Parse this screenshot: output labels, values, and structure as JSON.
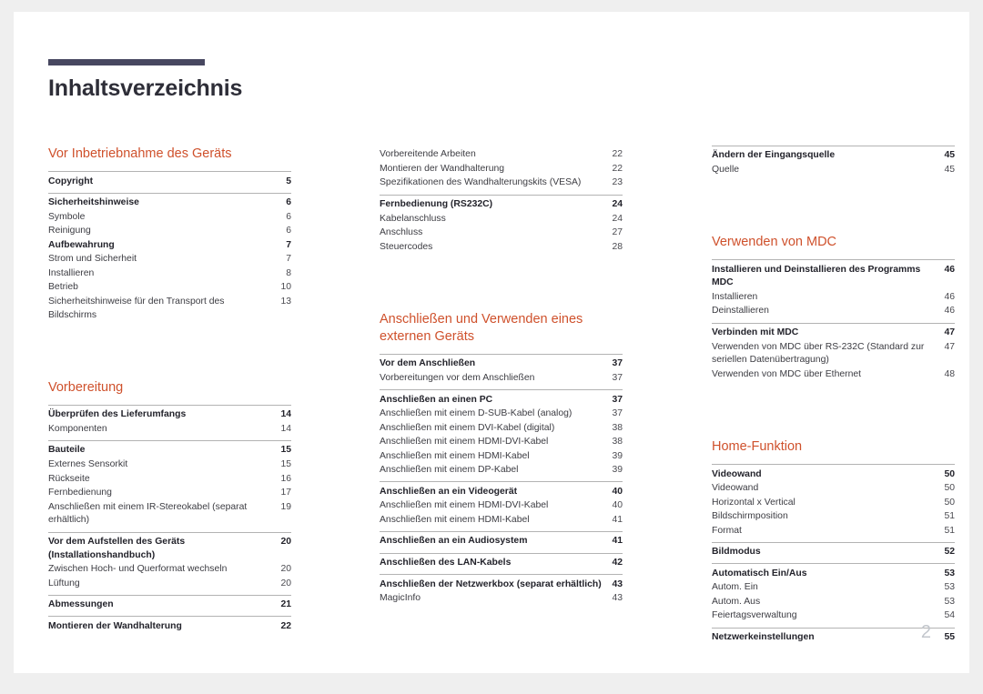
{
  "document": {
    "title": "Inhaltsverzeichnis",
    "folio": "2",
    "accent_color": "#cf512c",
    "rule_color": "#474760"
  },
  "columns": [
    {
      "id": "column-1",
      "sections": [
        {
          "heading": "Vor Inbetriebnahme des Geräts",
          "groups": [
            {
              "entries": [
                {
                  "label": "Copyright",
                  "page": "5",
                  "level": "head"
                }
              ]
            },
            {
              "entries": [
                {
                  "label": "Sicherheitshinweise",
                  "page": "6",
                  "level": "head"
                },
                {
                  "label": "Symbole",
                  "page": "6",
                  "level": "sub"
                },
                {
                  "label": "Reinigung",
                  "page": "6",
                  "level": "sub"
                },
                {
                  "label": "Aufbewahrung",
                  "page": "7",
                  "level": "head"
                },
                {
                  "label": "Strom und Sicherheit",
                  "page": "7",
                  "level": "sub"
                },
                {
                  "label": "Installieren",
                  "page": "8",
                  "level": "sub"
                },
                {
                  "label": "Betrieb",
                  "page": "10",
                  "level": "sub"
                },
                {
                  "label": "Sicherheitshinweise für den Transport des Bildschirms",
                  "page": "13",
                  "level": "sub"
                }
              ]
            }
          ]
        },
        {
          "heading": "Vorbereitung",
          "groups": [
            {
              "entries": [
                {
                  "label": "Überprüfen des Lieferumfangs",
                  "page": "14",
                  "level": "head"
                },
                {
                  "label": "Komponenten",
                  "page": "14",
                  "level": "sub"
                }
              ]
            },
            {
              "entries": [
                {
                  "label": "Bauteile",
                  "page": "15",
                  "level": "head"
                },
                {
                  "label": "Externes Sensorkit",
                  "page": "15",
                  "level": "sub"
                },
                {
                  "label": "Rückseite",
                  "page": "16",
                  "level": "sub"
                },
                {
                  "label": "Fernbedienung",
                  "page": "17",
                  "level": "sub"
                },
                {
                  "label": "Anschließen mit einem IR-Stereokabel (separat erhältlich)",
                  "page": "19",
                  "level": "sub"
                }
              ]
            },
            {
              "entries": [
                {
                  "label": "Vor dem Aufstellen des Geräts (Installationshandbuch)",
                  "page": "20",
                  "level": "head"
                },
                {
                  "label": "Zwischen Hoch- und Querformat wechseln",
                  "page": "20",
                  "level": "sub"
                },
                {
                  "label": "Lüftung",
                  "page": "20",
                  "level": "sub"
                }
              ]
            },
            {
              "entries": [
                {
                  "label": "Abmessungen",
                  "page": "21",
                  "level": "head"
                }
              ]
            },
            {
              "entries": [
                {
                  "label": "Montieren der Wandhalterung",
                  "page": "22",
                  "level": "head"
                }
              ]
            }
          ]
        }
      ]
    },
    {
      "id": "column-2",
      "sections": [
        {
          "heading": "",
          "groups": [
            {
              "no_rule": true,
              "entries": [
                {
                  "label": "Vorbereitende Arbeiten",
                  "page": "22",
                  "level": "sub"
                },
                {
                  "label": "Montieren der Wandhalterung",
                  "page": "22",
                  "level": "sub"
                },
                {
                  "label": "Spezifikationen des Wandhalterungskits (VESA)",
                  "page": "23",
                  "level": "sub"
                }
              ]
            },
            {
              "entries": [
                {
                  "label": "Fernbedienung (RS232C)",
                  "page": "24",
                  "level": "head"
                },
                {
                  "label": "Kabelanschluss",
                  "page": "24",
                  "level": "sub"
                },
                {
                  "label": "Anschluss",
                  "page": "27",
                  "level": "sub"
                },
                {
                  "label": "Steuercodes",
                  "page": "28",
                  "level": "sub"
                }
              ]
            }
          ]
        },
        {
          "heading": "Anschließen und Verwenden eines externen Geräts",
          "groups": [
            {
              "entries": [
                {
                  "label": "Vor dem Anschließen",
                  "page": "37",
                  "level": "head"
                },
                {
                  "label": "Vorbereitungen vor dem Anschließen",
                  "page": "37",
                  "level": "sub"
                }
              ]
            },
            {
              "entries": [
                {
                  "label": "Anschließen an einen PC",
                  "page": "37",
                  "level": "head"
                },
                {
                  "label": "Anschließen mit einem D-SUB-Kabel (analog)",
                  "page": "37",
                  "level": "sub"
                },
                {
                  "label": "Anschließen mit einem DVI-Kabel (digital)",
                  "page": "38",
                  "level": "sub"
                },
                {
                  "label": "Anschließen mit einem HDMI-DVI-Kabel",
                  "page": "38",
                  "level": "sub"
                },
                {
                  "label": "Anschließen mit einem HDMI-Kabel",
                  "page": "39",
                  "level": "sub"
                },
                {
                  "label": "Anschließen mit einem DP-Kabel",
                  "page": "39",
                  "level": "sub"
                }
              ]
            },
            {
              "entries": [
                {
                  "label": "Anschließen an ein Videogerät",
                  "page": "40",
                  "level": "head"
                },
                {
                  "label": "Anschließen mit einem HDMI-DVI-Kabel",
                  "page": "40",
                  "level": "sub"
                },
                {
                  "label": "Anschließen mit einem HDMI-Kabel",
                  "page": "41",
                  "level": "sub"
                }
              ]
            },
            {
              "entries": [
                {
                  "label": "Anschließen an ein Audiosystem",
                  "page": "41",
                  "level": "head"
                }
              ]
            },
            {
              "entries": [
                {
                  "label": "Anschließen des LAN-Kabels",
                  "page": "42",
                  "level": "head"
                }
              ]
            },
            {
              "entries": [
                {
                  "label": "Anschließen der Netzwerkbox (separat erhältlich)",
                  "page": "43",
                  "level": "head"
                },
                {
                  "label": "MagicInfo",
                  "page": "43",
                  "level": "sub"
                }
              ]
            }
          ]
        }
      ]
    },
    {
      "id": "column-3",
      "sections": [
        {
          "heading": "",
          "groups": [
            {
              "entries": [
                {
                  "label": "Ändern der Eingangsquelle",
                  "page": "45",
                  "level": "head"
                },
                {
                  "label": "Quelle",
                  "page": "45",
                  "level": "sub"
                }
              ]
            }
          ]
        },
        {
          "heading": "Verwenden von MDC",
          "groups": [
            {
              "entries": [
                {
                  "label": "Installieren und Deinstallieren des Programms MDC",
                  "page": "46",
                  "level": "head"
                },
                {
                  "label": "Installieren",
                  "page": "46",
                  "level": "sub"
                },
                {
                  "label": "Deinstallieren",
                  "page": "46",
                  "level": "sub"
                }
              ]
            },
            {
              "entries": [
                {
                  "label": "Verbinden mit MDC",
                  "page": "47",
                  "level": "head"
                },
                {
                  "label": "Verwenden von MDC über RS-232C (Standard zur seriellen Datenübertragung)",
                  "page": "47",
                  "level": "sub"
                },
                {
                  "label": "Verwenden von MDC über Ethernet",
                  "page": "48",
                  "level": "sub"
                }
              ]
            }
          ]
        },
        {
          "heading": "Home-Funktion",
          "groups": [
            {
              "entries": [
                {
                  "label": "Videowand",
                  "page": "50",
                  "level": "head"
                },
                {
                  "label": "Videowand",
                  "page": "50",
                  "level": "sub"
                },
                {
                  "label": "Horizontal x Vertical",
                  "page": "50",
                  "level": "sub"
                },
                {
                  "label": "Bildschirmposition",
                  "page": "51",
                  "level": "sub"
                },
                {
                  "label": "Format",
                  "page": "51",
                  "level": "sub"
                }
              ]
            },
            {
              "entries": [
                {
                  "label": "Bildmodus",
                  "page": "52",
                  "level": "head"
                }
              ]
            },
            {
              "entries": [
                {
                  "label": "Automatisch Ein/Aus",
                  "page": "53",
                  "level": "head"
                },
                {
                  "label": "Autom. Ein",
                  "page": "53",
                  "level": "sub"
                },
                {
                  "label": "Autom. Aus",
                  "page": "53",
                  "level": "sub"
                },
                {
                  "label": "Feiertagsverwaltung",
                  "page": "54",
                  "level": "sub"
                }
              ]
            },
            {
              "entries": [
                {
                  "label": "Netzwerkeinstellungen",
                  "page": "55",
                  "level": "head"
                }
              ]
            }
          ]
        }
      ]
    }
  ]
}
